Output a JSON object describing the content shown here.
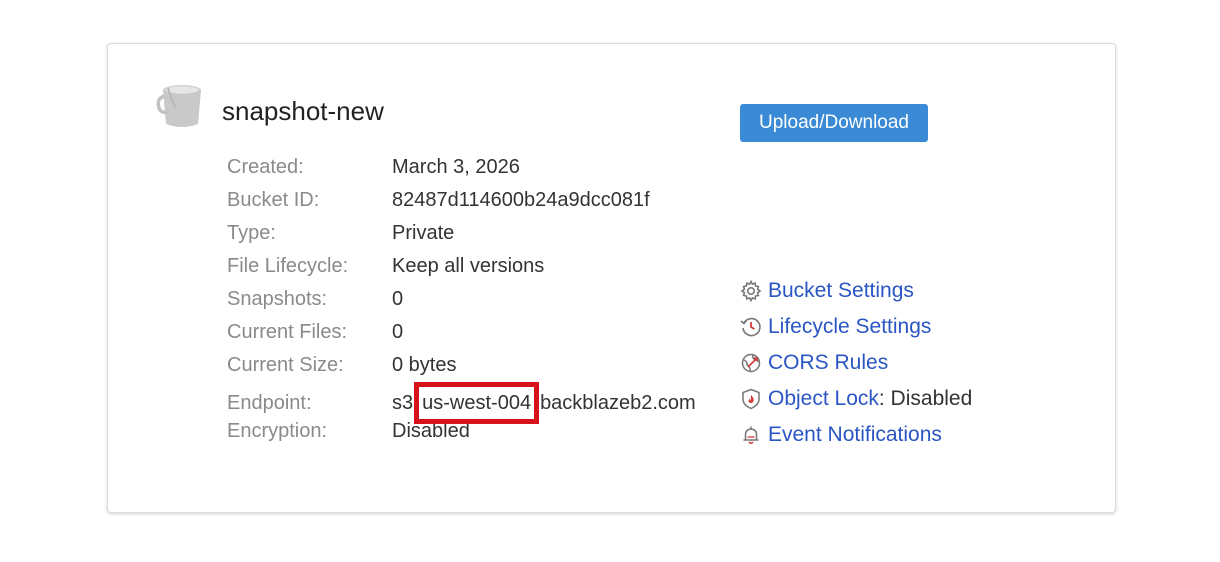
{
  "bucket": {
    "name": "snapshot-new"
  },
  "details": [
    {
      "label": "Created:",
      "value": "March 3, 2026"
    },
    {
      "label": "Bucket ID:",
      "value": "82487d114600b24a9dcc081f"
    },
    {
      "label": "Type:",
      "value": "Private"
    },
    {
      "label": "File Lifecycle:",
      "value": "Keep all versions"
    },
    {
      "label": "Snapshots:",
      "value": "0"
    },
    {
      "label": "Current Files:",
      "value": "0"
    },
    {
      "label": "Current Size:",
      "value": "0 bytes"
    }
  ],
  "endpoint": {
    "label": "Endpoint:",
    "prefix": "s3",
    "region": "us-west-004",
    "suffix": "backblazeb2.com"
  },
  "encryption": {
    "label": "Encryption:",
    "value": "Disabled"
  },
  "actions": {
    "upload_download": "Upload/Download"
  },
  "links": {
    "bucket_settings": "Bucket Settings",
    "lifecycle_settings": "Lifecycle Settings",
    "cors_rules": "CORS Rules",
    "object_lock": "Object Lock",
    "object_lock_status": ": Disabled",
    "event_notifications": "Event Notifications"
  },
  "colors": {
    "link": "#2a55c4",
    "button": "#3a8ad5",
    "highlight": "#d8121a"
  }
}
